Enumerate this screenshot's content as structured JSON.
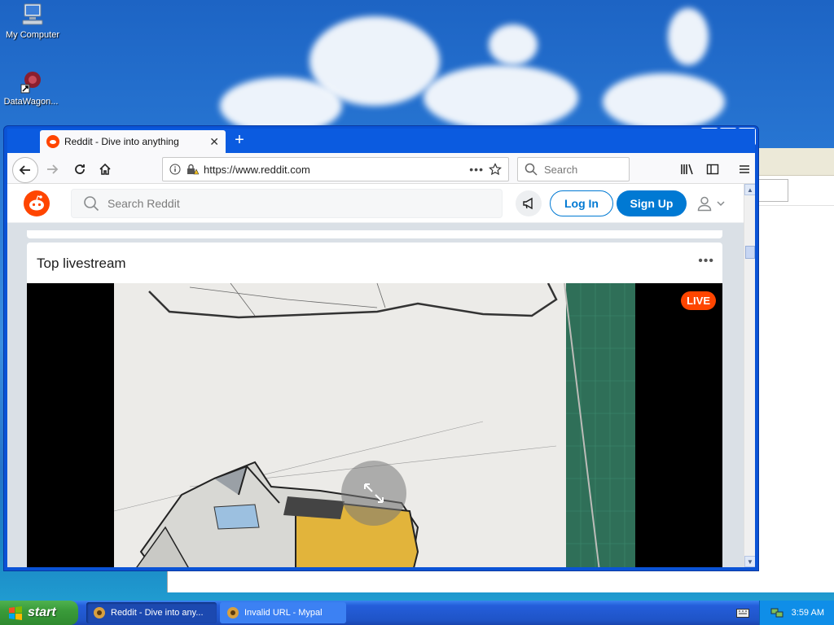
{
  "desktop": {
    "icons": [
      {
        "label": "My Computer"
      },
      {
        "label": "DataWagon..."
      }
    ]
  },
  "browser": {
    "tab_title": "Reddit - Dive into anything",
    "url": "https://www.reddit.com",
    "search_placeholder": "Search"
  },
  "reddit": {
    "search_placeholder": "Search Reddit",
    "login_label": "Log In",
    "signup_label": "Sign Up",
    "card_title": "Top livestream",
    "more_label": "•••",
    "live_badge": "LIVE"
  },
  "taskbar": {
    "start_label": "start",
    "tasks": [
      {
        "label": "Reddit - Dive into any..."
      },
      {
        "label": "Invalid URL - Mypal"
      }
    ],
    "clock": "3:59 AM"
  },
  "colors": {
    "reddit_orange": "#ff4500",
    "reddit_blue": "#0079d3",
    "xp_blue": "#0a53d6"
  }
}
